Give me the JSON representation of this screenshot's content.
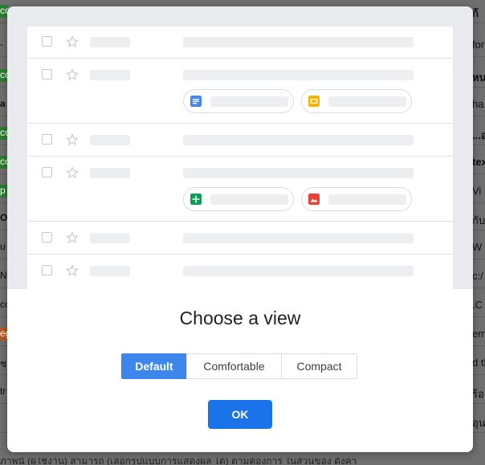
{
  "background_list": {
    "right_fragments": [
      "ก้",
      "for",
      "หน",
      "ha",
      "...อ",
      "tex",
      "Vi",
      "กับ",
      "W",
      "c:/",
      ".C",
      "em",
      "d tl",
      "ร้อย",
      "อุน"
    ],
    "left_fragments": [
      "co",
      "-",
      "co",
      "a",
      "co",
      "co",
      "p",
      "O",
      "u",
      "N",
      "cc",
      "eg",
      "ช",
      "tr",
      ""
    ],
    "bottom_text": "ภาพนี้ (ผู้ใช้งาน) สามารถ (เลือกรูปแบบการแสดงผล ได้) ตามต้องการ ในส่วนของ ตั้งค่า"
  },
  "modal": {
    "title": "Choose a view",
    "view_options": [
      {
        "label": "Default",
        "selected": true
      },
      {
        "label": "Comfortable",
        "selected": false
      },
      {
        "label": "Compact",
        "selected": false
      }
    ],
    "ok_label": "OK",
    "attachment_icons": [
      {
        "name": "google-docs-icon",
        "color": "#4285f4"
      },
      {
        "name": "google-slides-icon",
        "color": "#f4b400"
      },
      {
        "name": "google-sheets-icon",
        "color": "#0f9d58"
      },
      {
        "name": "image-file-icon",
        "color": "#ea4335"
      }
    ]
  },
  "colors": {
    "accent": "#1a73e8",
    "selected_segment": "#3d87ec",
    "preview_background": "#e8eaed"
  }
}
